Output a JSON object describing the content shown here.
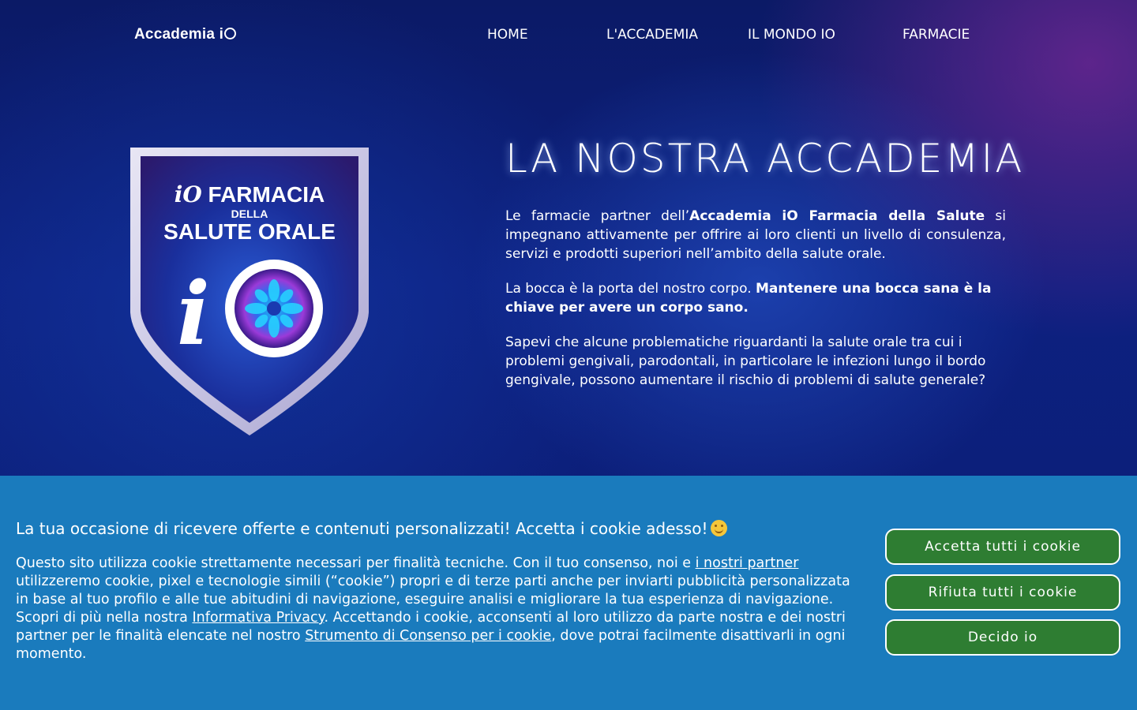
{
  "header": {
    "logo_text": "Accademia i",
    "nav": [
      "HOME",
      "L'ACCADEMIA",
      "IL MONDO IO",
      "FARMACIE"
    ]
  },
  "badge": {
    "line1_mark": "iO",
    "line1_word": "FARMACIA",
    "line2": "DELLA",
    "line3": "SALUTE ORALE",
    "big_mark": "iO"
  },
  "main": {
    "title": "LA NOSTRA ACCADEMIA",
    "p1_a": "Le farmacie partner dell’",
    "p1_b": "Accademia iO Farmacia della Salute",
    "p1_c": " si impegnano attivamente per offrire ai loro clienti un livello di consulenza, servizi e prodotti superiori nell’ambito della salute orale.",
    "p2_a": "La bocca è la porta del nostro corpo. ",
    "p2_b": "Mantenere una bocca sana è la chiave per avere un corpo sano.",
    "p3": "Sapevi che alcune problematiche riguardanti la salute orale tra cui i problemi gengivali, parodontali, in particolare le infezioni lungo il bordo gengivale, possono aumentare il rischio di problemi di salute generale?"
  },
  "cookie": {
    "title": "La tua occasione di ricevere offerte e contenuti personalizzati! Accetta i cookie adesso!",
    "emoji_icon": "smiling-face-icon",
    "body_1": "Questo sito utilizza cookie strettamente necessari per finalità tecniche. Con il tuo consenso, noi e ",
    "link_partners": "i nostri partner",
    "body_2": " utilizzeremo cookie, pixel e tecnologie simili (“cookie”) propri e di terze parti anche per inviarti pubblicità personalizzata in base al tuo profilo e alle tue abitudini di navigazione, eseguire analisi e migliorare la tua esperienza di navigazione. Scopri di più nella nostra ",
    "link_privacy": "Informativa Privacy",
    "body_3": ". Accettando i cookie, acconsenti al loro utilizzo da parte nostra e dei nostri partner per le finalità elencate nel nostro ",
    "link_consent": "Strumento di Consenso per i cookie",
    "body_4": ", dove potrai facilmente disattivarli in ogni momento.",
    "btn_accept": "Accetta tutti i cookie",
    "btn_reject": "Rifiuta tutti i cookie",
    "btn_decide": "Decido io"
  },
  "colors": {
    "cookie_bg": "#1a7bbd",
    "button_green": "#2e7d32",
    "hero_blue": "#0d2080"
  }
}
